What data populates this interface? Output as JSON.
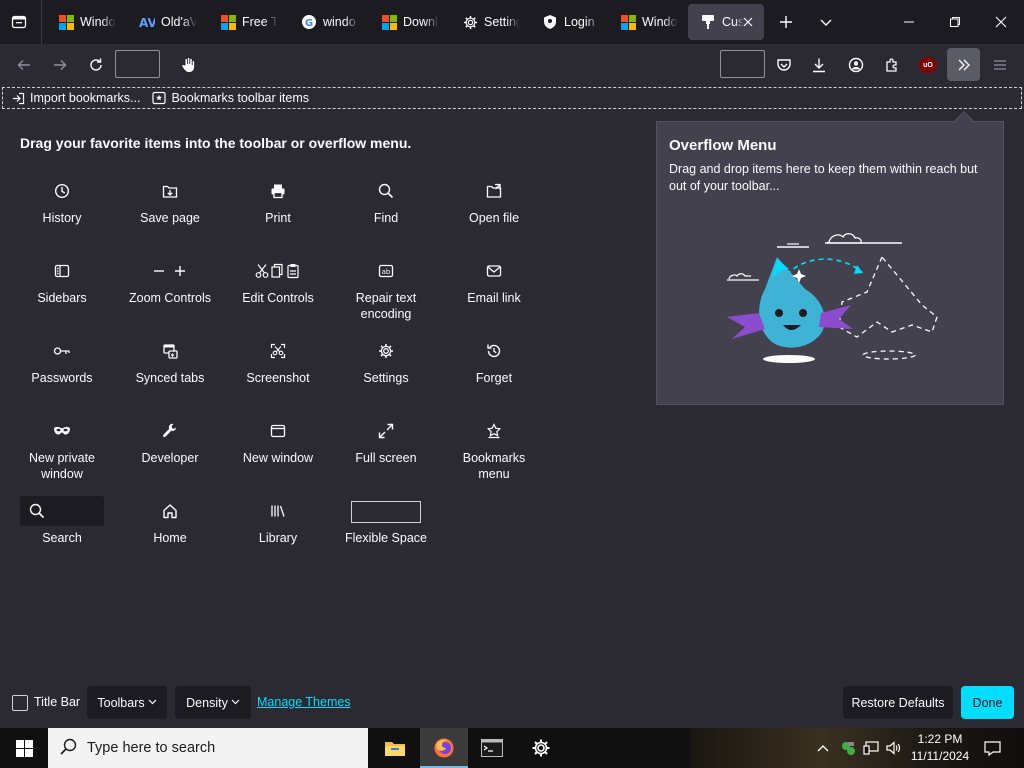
{
  "tabs": [
    {
      "title": "Windo",
      "favicon": "microsoft-icon"
    },
    {
      "title": "Old'aV",
      "favicon": "av-icon"
    },
    {
      "title": "Free Tr",
      "favicon": "microsoft-icon"
    },
    {
      "title": "windo",
      "favicon": "google-icon"
    },
    {
      "title": "Downl",
      "favicon": "microsoft-icon"
    },
    {
      "title": "Setting",
      "favicon": "gear-icon"
    },
    {
      "title": "Login",
      "favicon": "shield-icon"
    },
    {
      "title": "Windo",
      "favicon": "microsoft-icon"
    },
    {
      "title": "Cus",
      "favicon": "brush-icon",
      "active": true
    }
  ],
  "bookmarks": {
    "import_label": "Import bookmarks...",
    "toolbar_items_label": "Bookmarks toolbar items"
  },
  "palette": {
    "heading": "Drag your favorite items into the toolbar or overflow menu.",
    "items": [
      {
        "label": "History",
        "icon": "clock-icon"
      },
      {
        "label": "Save page",
        "icon": "save-page-icon"
      },
      {
        "label": "Print",
        "icon": "printer-icon"
      },
      {
        "label": "Find",
        "icon": "search-icon"
      },
      {
        "label": "Open file",
        "icon": "open-folder-icon"
      },
      {
        "label": "Sidebars",
        "icon": "sidebar-icon"
      },
      {
        "label": "Zoom Controls",
        "icon": "zoom-icon"
      },
      {
        "label": "Edit Controls",
        "icon": "edit-icon"
      },
      {
        "label": "Repair text encoding",
        "icon": "text-encoding-icon"
      },
      {
        "label": "Email link",
        "icon": "mail-icon"
      },
      {
        "label": "Passwords",
        "icon": "key-icon"
      },
      {
        "label": "Synced tabs",
        "icon": "synced-tabs-icon"
      },
      {
        "label": "Screenshot",
        "icon": "screenshot-icon"
      },
      {
        "label": "Settings",
        "icon": "gear-icon"
      },
      {
        "label": "Forget",
        "icon": "forget-icon"
      },
      {
        "label": "New private window",
        "icon": "private-mask-icon"
      },
      {
        "label": "Developer",
        "icon": "wrench-icon"
      },
      {
        "label": "New window",
        "icon": "window-icon"
      },
      {
        "label": "Full screen",
        "icon": "fullscreen-icon"
      },
      {
        "label": "Bookmarks menu",
        "icon": "bookmark-star-icon"
      },
      {
        "label": "Search",
        "icon": "search-icon"
      },
      {
        "label": "Home",
        "icon": "home-icon"
      },
      {
        "label": "Library",
        "icon": "library-icon"
      },
      {
        "label": "Flexible Space",
        "icon": "flexible-space"
      }
    ]
  },
  "overflow": {
    "title": "Overflow Menu",
    "description": "Drag and drop items here to keep them within reach but out of your toolbar..."
  },
  "footer": {
    "title_bar_label": "Title Bar",
    "title_bar_checked": false,
    "toolbars_label": "Toolbars",
    "density_label": "Density",
    "manage_themes_label": "Manage Themes",
    "restore_label": "Restore Defaults",
    "done_label": "Done"
  },
  "taskbar": {
    "search_placeholder": "Type here to search",
    "time": "1:22 PM",
    "date": "11/11/2024"
  },
  "colors": {
    "accent": "#00ddff",
    "background": "#2b2a33",
    "tabstrip": "#1c1b22"
  }
}
